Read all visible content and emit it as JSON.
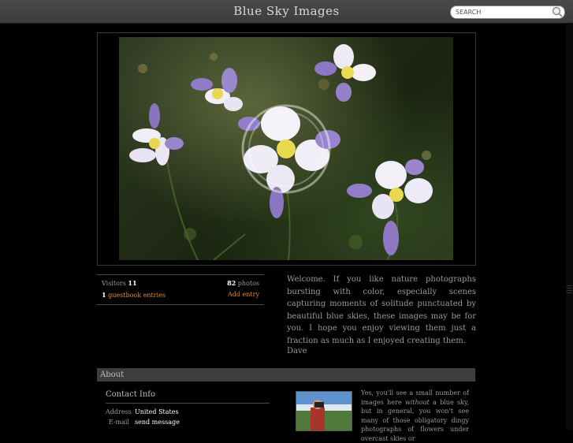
{
  "site": {
    "title": "Blue Sky Images"
  },
  "search": {
    "placeholder": "SEARCH"
  },
  "stats": {
    "visitors_label": "Visitors",
    "visitors_count": "11",
    "photos_count": "82",
    "photos_label": "photos",
    "guestbook_count": "1",
    "guestbook_label": "guestbook entries",
    "add_entry": "Add entry"
  },
  "welcome": {
    "text": "Welcome. If you like nature photographs bursting with color, especially scenes capturing moments of solitude punctuated by beautiful blue skies, these images may be for you. I hope you enjoy viewing them just a fraction as much as I enjoyed creating them.",
    "signature": "Dave"
  },
  "about": {
    "heading": "About",
    "contact_title": "Contact Info",
    "address_label": "Address",
    "address_value": "United States",
    "email_label": "E-mail",
    "email_value": "send message",
    "text_before": "Yes, you'll see a small number of images here ",
    "text_emphasis": "without",
    "text_after": " a blue sky, but in general, you won't see many of those obligatory dingy photographs of flowers under overcast skies or"
  },
  "colors": {
    "accent": "#e08a2a",
    "bar": "#3d3d3d",
    "background": "#000000"
  }
}
